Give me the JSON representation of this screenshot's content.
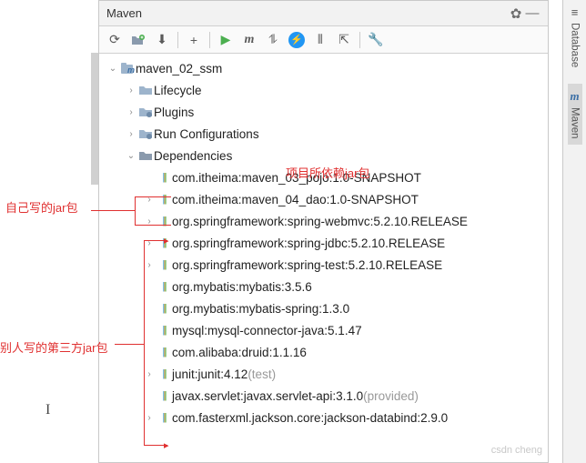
{
  "header": {
    "title": "Maven"
  },
  "rail": {
    "database": "Database",
    "maven": "Maven"
  },
  "tree": {
    "root": "maven_02_ssm",
    "nodes": {
      "lifecycle": "Lifecycle",
      "plugins": "Plugins",
      "runconfig": "Run Configurations",
      "dependencies": "Dependencies"
    },
    "deps": [
      {
        "label": "com.itheima:maven_03_pojo:1.0-SNAPSHOT",
        "expandable": false
      },
      {
        "label": "com.itheima:maven_04_dao:1.0-SNAPSHOT",
        "expandable": true
      },
      {
        "label": "org.springframework:spring-webmvc:5.2.10.RELEASE",
        "expandable": true
      },
      {
        "label": "org.springframework:spring-jdbc:5.2.10.RELEASE",
        "expandable": true
      },
      {
        "label": "org.springframework:spring-test:5.2.10.RELEASE",
        "expandable": true
      },
      {
        "label": "org.mybatis:mybatis:3.5.6",
        "expandable": false
      },
      {
        "label": "org.mybatis:mybatis-spring:1.3.0",
        "expandable": false
      },
      {
        "label": "mysql:mysql-connector-java:5.1.47",
        "expandable": false
      },
      {
        "label": "com.alibaba:druid:1.1.16",
        "expandable": false
      },
      {
        "label": "junit:junit:4.12",
        "scope": "(test)",
        "expandable": true
      },
      {
        "label": "javax.servlet:javax.servlet-api:3.1.0",
        "scope": "(provided)",
        "expandable": false
      },
      {
        "label": "com.fasterxml.jackson.core:jackson-databind:2.9.0",
        "expandable": true
      }
    ]
  },
  "annotations": {
    "projectDeps": "项目所依赖jar包",
    "ownJar": "自己写的jar包",
    "thirdParty": "别人写的第三方jar包"
  },
  "watermark": "csdn cheng"
}
